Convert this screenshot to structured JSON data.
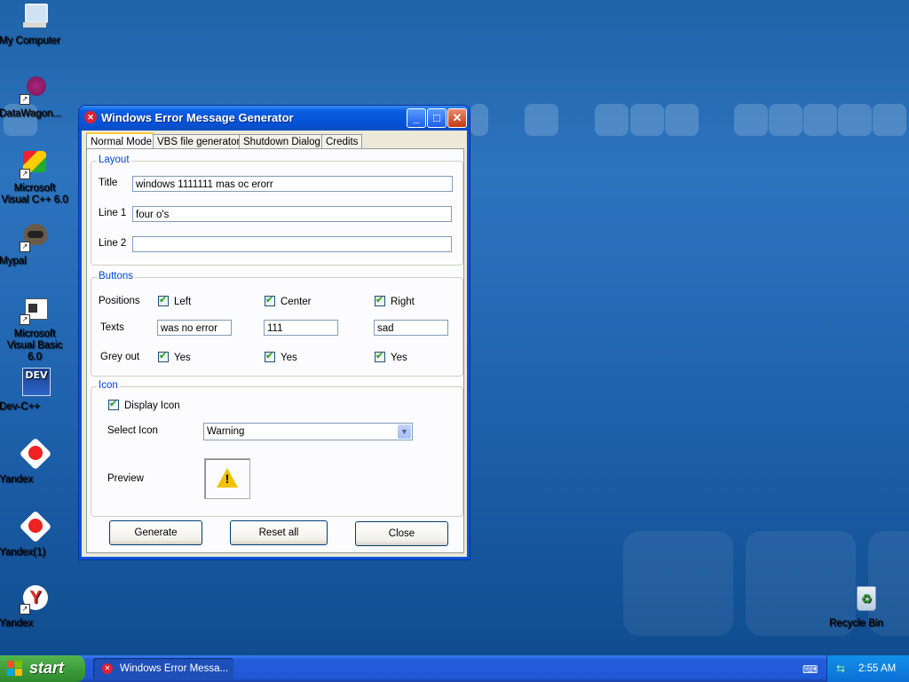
{
  "desktop": {
    "icons": [
      {
        "name": "My Computer"
      },
      {
        "name": "DataWagon..."
      },
      {
        "name": "Microsoft Visual C++ 6.0"
      },
      {
        "name": "Mypal"
      },
      {
        "name": "Microsoft Visual Basic 6.0"
      },
      {
        "name": "Dev-C++"
      },
      {
        "name": "Yandex"
      },
      {
        "name": "Yandex(1)"
      },
      {
        "name": "Yandex"
      },
      {
        "name": "Recycle Bin"
      }
    ]
  },
  "window": {
    "title": "Windows Error Message Generator",
    "tabs": [
      "Normal Mode",
      "VBS file generator",
      "Shutdown Dialog",
      "Credits"
    ],
    "layout": {
      "group_title": "Layout",
      "title_label": "Title",
      "title_value": "windows 1111111 mas oc erorr",
      "line1_label": "Line 1",
      "line1_value": "four o's",
      "line2_label": "Line 2",
      "line2_value": ""
    },
    "buttons_group": {
      "group_title": "Buttons",
      "positions_label": "Positions",
      "texts_label": "Texts",
      "greyout_label": "Grey out",
      "left_label": "Left",
      "center_label": "Center",
      "right_label": "Right",
      "left_text": "was no error",
      "center_text": "111",
      "right_text": "sad",
      "yes_label": "Yes"
    },
    "icon_group": {
      "group_title": "Icon",
      "display_icon_label": "Display Icon",
      "select_icon_label": "Select Icon",
      "select_icon_value": "Warning",
      "preview_label": "Preview"
    },
    "actions": {
      "generate": "Generate",
      "reset": "Reset all",
      "close": "Close"
    }
  },
  "taskbar": {
    "start_label": "start",
    "task_item": "Windows Error Messa...",
    "clock": "2:55 AM"
  }
}
